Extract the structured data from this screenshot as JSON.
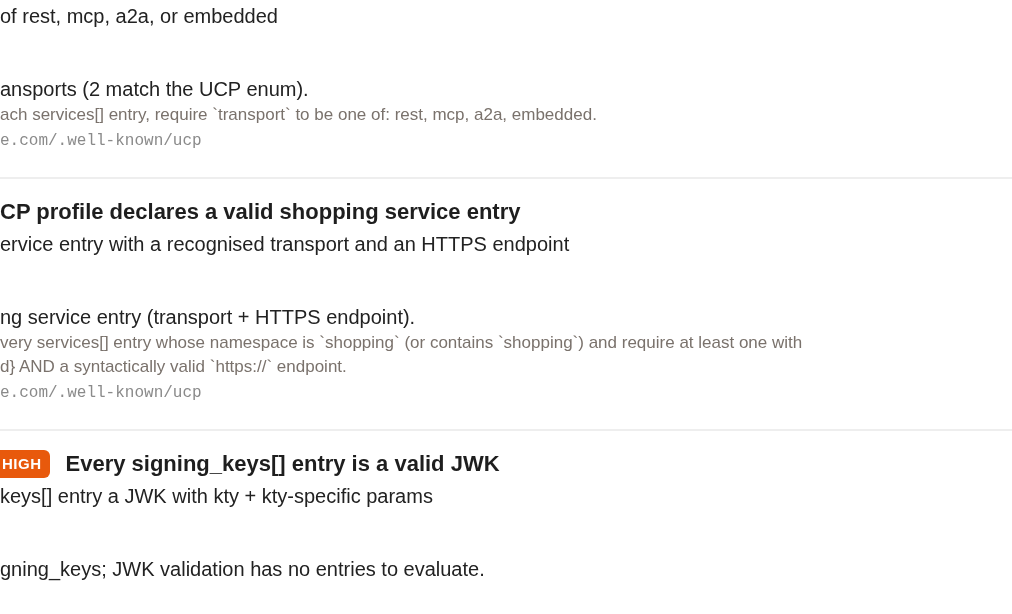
{
  "checks": [
    {
      "description": "of rest, mcp, a2a, or embedded",
      "result": "ansports (2 match the UCP enum).",
      "detail": "ach services[] entry, require `transport` to be one of: rest, mcp, a2a, embedded.",
      "url": "e.com/.well-known/ucp"
    },
    {
      "title": "CP profile declares a valid shopping service entry",
      "description": "ervice entry with a recognised transport and an HTTPS endpoint",
      "result": "ng service entry (transport + HTTPS endpoint).",
      "detail": "very services[] entry whose namespace is `shopping` (or contains `shopping`) and require at least one with\nd} AND a syntactically valid `https://` endpoint.",
      "url": "e.com/.well-known/ucp"
    },
    {
      "severity": {
        "label": "HIGH",
        "kind": "high"
      },
      "title": "Every signing_keys[] entry is a valid JWK",
      "description": "keys[] entry a JWK with kty + kty-specific params",
      "result": "gning_keys; JWK validation has no entries to evaluate."
    }
  ]
}
